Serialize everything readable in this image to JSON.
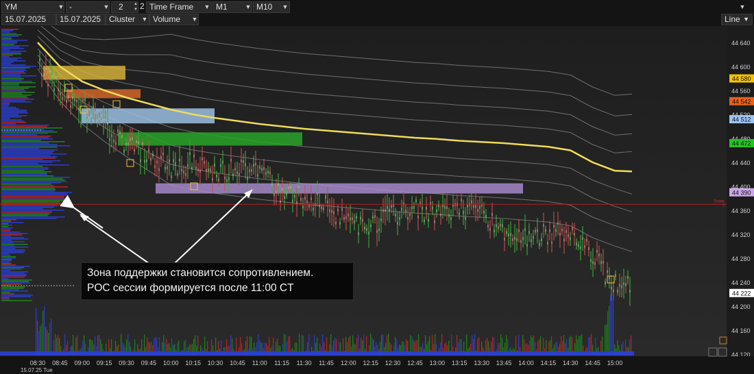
{
  "toolbar": {
    "symbol": "YM",
    "dash": "-",
    "count": "2",
    "count2": "2",
    "timeframe_label": "Time Frame",
    "tf1": "M1",
    "tf2": "M10",
    "date_from": "15.07.2025",
    "date_to": "15.07.2025",
    "chart_type": "Cluster",
    "metric": "Volume",
    "view_mode": "Line"
  },
  "chart_data": {
    "type": "line",
    "title": "",
    "xlabel": "",
    "ylabel": "",
    "ylim": [
      44100,
      44660
    ],
    "y_ticks": [
      44640,
      44600,
      44560,
      44520,
      44480,
      44440,
      44400,
      44360,
      44320,
      44280,
      44240,
      44200,
      44160,
      44120
    ],
    "x_ticks": [
      "08:30",
      "08:45",
      "09:00",
      "09:15",
      "09:30",
      "09:45",
      "10:00",
      "10:15",
      "10:30",
      "10:45",
      "11:00",
      "11:15",
      "11:30",
      "11:45",
      "12:00",
      "12:15",
      "12:30",
      "12:45",
      "13:00",
      "13:15",
      "13:30",
      "13:45",
      "14:00",
      "14:15",
      "14:30",
      "14:45",
      "15:00"
    ],
    "date_label": "15.07.25 Tue",
    "price_badges": [
      {
        "value": "44 580",
        "color": "#f2c200"
      },
      {
        "value": "44 542",
        "color": "#e8611a"
      },
      {
        "value": "44 512",
        "color": "#9ec3f0"
      },
      {
        "value": "44 472",
        "color": "#22c422"
      },
      {
        "value": "44 390",
        "color": "#c9a6e8"
      },
      {
        "value": "44 222",
        "color": "#ffffff"
      }
    ],
    "today_label": "Today",
    "today_value": "?",
    "zones": [
      {
        "from": 44578,
        "to": 44601,
        "color": "#d9b43a"
      },
      {
        "from": 44547,
        "to": 44562,
        "color": "#d9682a"
      },
      {
        "from": 44505,
        "to": 44530,
        "color": "#9fc4e8"
      },
      {
        "from": 44468,
        "to": 44490,
        "color": "#28a828"
      },
      {
        "from": 44388,
        "to": 44405,
        "color": "#a98ccf"
      }
    ],
    "today_line": 44370,
    "series": [
      {
        "values": [
          44640,
          44600,
          44575,
          44560,
          44548,
          44538,
          44528,
          44520,
          44514,
          44509,
          44504,
          44500,
          44496,
          44493,
          44490,
          44487,
          44484,
          44481,
          44479,
          44476,
          44474,
          44472,
          44469,
          44466,
          44460,
          44440,
          44426
        ],
        "color": "#f0dc5a"
      }
    ],
    "accent_colors": {
      "background": "#1c1c1c",
      "blue_volume": "#2a3fd8",
      "green_volume": "#1d8a1d",
      "red_volume": "#c42424"
    }
  },
  "annotation": {
    "line1": "Зона поддержки становится сопротивлением.",
    "line2": "POC сессии формируется после 11:00 CT"
  }
}
